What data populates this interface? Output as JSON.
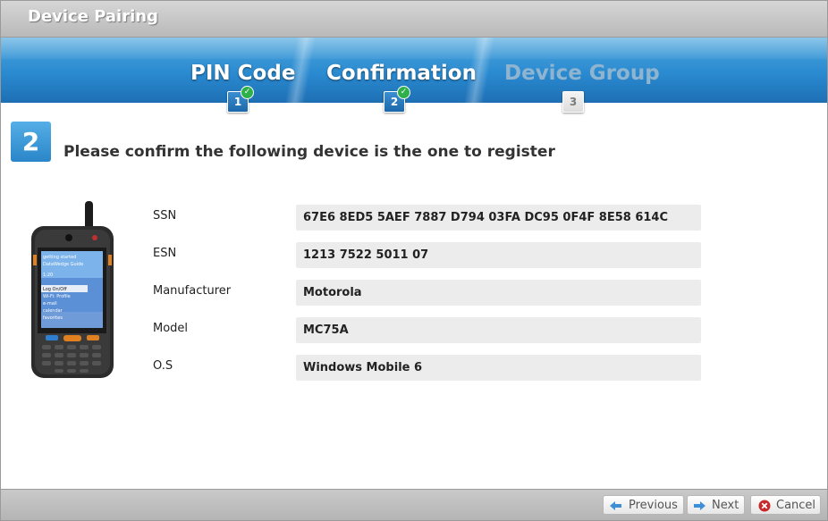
{
  "window": {
    "title": "Device Pairing"
  },
  "wizard": {
    "steps": [
      {
        "label": "PIN Code",
        "number": "1",
        "state": "completed"
      },
      {
        "label": "Confirmation",
        "number": "2",
        "state": "current"
      },
      {
        "label": "Device Group",
        "number": "3",
        "state": "pending"
      }
    ],
    "check_mark": "✓"
  },
  "content": {
    "step_number": "2",
    "prompt": "Please confirm the following device is the one to register",
    "fields": [
      {
        "label": "SSN",
        "value": "67E6 8ED5 5AEF 7887 D794 03FA DC95 0F4F 8E58 614C"
      },
      {
        "label": "ESN",
        "value": "1213 7522 5011 07"
      },
      {
        "label": "Manufacturer",
        "value": "Motorola"
      },
      {
        "label": "Model",
        "value": "MC75A"
      },
      {
        "label": "O.S",
        "value": "Windows Mobile 6"
      }
    ],
    "device_screen": {
      "lines": [
        "getting started",
        "DataWedge Guide",
        "1:20",
        "Log On/Off",
        "Wi-Fi: Profile",
        "e-mail",
        "calendar",
        "favorites"
      ]
    }
  },
  "footer": {
    "previous_label": "Previous",
    "next_label": "Next",
    "cancel_label": "Cancel"
  },
  "colors": {
    "accent": "#2a8ad0",
    "check_green": "#2fb04a",
    "cancel_red": "#c8282a"
  }
}
